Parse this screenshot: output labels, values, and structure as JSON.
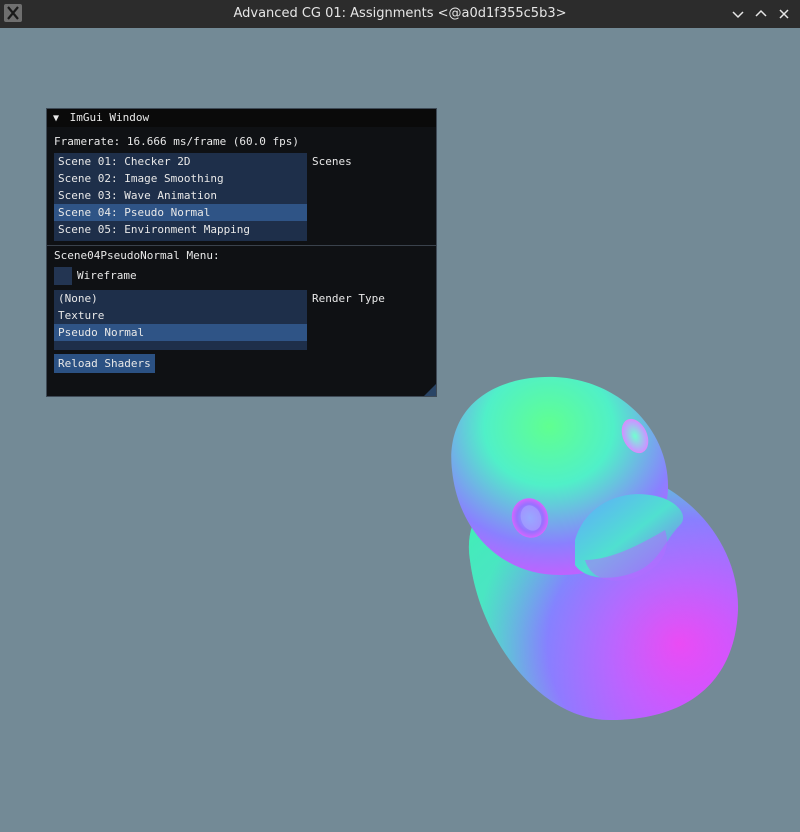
{
  "titlebar": {
    "title": "Advanced CG 01: Assignments <@a0d1f355c5b3>",
    "icons": {
      "app": "x11-app-icon",
      "minimize": "chevron-down-icon",
      "maximize": "chevron-up-icon",
      "close": "close-icon"
    }
  },
  "imgui": {
    "window_title": "ImGui Window",
    "collapse_arrow": "▼",
    "framerate": "Framerate: 16.666 ms/frame (60.0 fps)",
    "scenes_label": "Scenes",
    "scenes": [
      "Scene 01: Checker 2D",
      "Scene 02: Image Smoothing",
      "Scene 03: Wave Animation",
      "Scene 04: Pseudo Normal",
      "Scene 05: Environment Mapping"
    ],
    "selected_scene": "Scene 04: Pseudo Normal",
    "menu_header": "Scene04PseudoNormal Menu:",
    "wireframe_label": "Wireframe",
    "wireframe_checked": false,
    "render_type_label": "Render Type",
    "render_types": [
      "(None)",
      "Texture",
      "Pseudo Normal"
    ],
    "selected_render_type": "Pseudo Normal",
    "reload_button": "Reload Shaders"
  },
  "colors": {
    "background": "#738a96",
    "titlebar": "#2c2c2c",
    "imgui_bg": "#0f1114",
    "listbox_bg": "#1e2f4a",
    "selected": "#2f5486",
    "button": "#2b5183"
  }
}
